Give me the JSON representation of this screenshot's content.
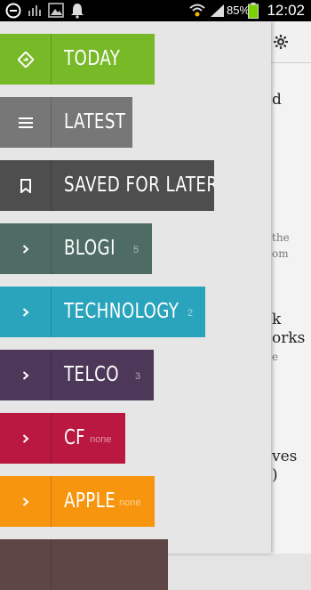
{
  "status_bar": {
    "battery_percent": "85%",
    "time": "12:02",
    "icons": [
      "minus-circle-icon",
      "signal-bars-icon",
      "image-icon",
      "bell-icon",
      "wifi-icon",
      "cellular-signal-icon",
      "battery-icon"
    ]
  },
  "background_article": {
    "texts": [
      "d",
      "the",
      "om",
      "k",
      "orks",
      "e",
      "ves",
      ")"
    ]
  },
  "drawer": {
    "items": [
      {
        "label": "TODAY",
        "icon": "today-diamond-icon",
        "color": "#78b928",
        "count": ""
      },
      {
        "label": "LATEST",
        "icon": "list-lines-icon",
        "color": "#777777",
        "count": ""
      },
      {
        "label": "SAVED FOR LATER",
        "icon": "bookmark-icon",
        "color": "#4e4e4e",
        "count": ""
      },
      {
        "label": "BLOGI",
        "icon": "chevron-right-icon",
        "color": "#4e6b64",
        "count": "5"
      },
      {
        "label": "TECHNOLOGY",
        "icon": "chevron-right-icon",
        "color": "#2aa4bc",
        "count": "2"
      },
      {
        "label": "TELCO",
        "icon": "chevron-right-icon",
        "color": "#4d3859",
        "count": "3"
      },
      {
        "label": "CF",
        "icon": "chevron-right-icon",
        "color": "#ba1840",
        "count": "none"
      },
      {
        "label": "APPLE",
        "icon": "chevron-right-icon",
        "color": "#f7960e",
        "count": "none"
      },
      {
        "label": "",
        "icon": "",
        "color": "#5e4646",
        "count": ""
      }
    ]
  }
}
